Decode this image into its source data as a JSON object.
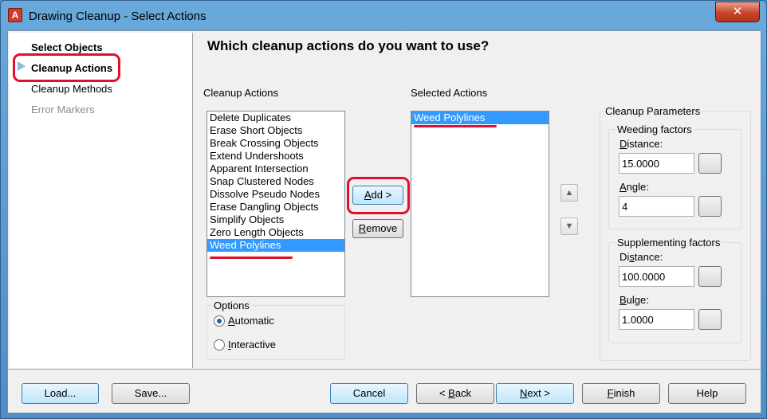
{
  "window": {
    "title": "Drawing Cleanup - Select Actions",
    "close_label": "✕"
  },
  "nav": {
    "items": [
      "Select Objects",
      "Cleanup Actions",
      "Cleanup Methods",
      "Error Markers"
    ]
  },
  "main": {
    "heading": "Which cleanup actions do you want to use?",
    "cleanup_actions_label": "Cleanup Actions",
    "selected_actions_label": "Selected Actions",
    "cleanup_actions": [
      "Delete Duplicates",
      "Erase Short Objects",
      "Break Crossing Objects",
      "Extend Undershoots",
      "Apparent Intersection",
      "Snap Clustered Nodes",
      "Dissolve Pseudo Nodes",
      "Erase Dangling Objects",
      "Simplify Objects",
      "Zero Length Objects",
      "Weed Polylines"
    ],
    "selected_actions": [
      "Weed Polylines"
    ],
    "add_label": "Add >",
    "remove_label": "Remove",
    "options": {
      "title": "Options",
      "automatic": "Automatic",
      "interactive": "Interactive"
    },
    "params": {
      "title": "Cleanup Parameters",
      "weeding": {
        "title": "Weeding factors",
        "distance_label": "Distance:",
        "distance_value": "15.0000",
        "angle_label": "Angle:",
        "angle_value": "4"
      },
      "supplementing": {
        "title": "Supplementing factors",
        "distance_label": "Distance:",
        "distance_value": "100.0000",
        "bulge_label": "Bulge:",
        "bulge_value": "1.0000"
      }
    }
  },
  "footer": {
    "load": "Load...",
    "save": "Save...",
    "cancel": "Cancel",
    "back": "< Back",
    "next": "Next >",
    "finish": "Finish",
    "help": "Help"
  },
  "colors": {
    "annotation": "#e0102c",
    "selection": "#3399ff"
  }
}
